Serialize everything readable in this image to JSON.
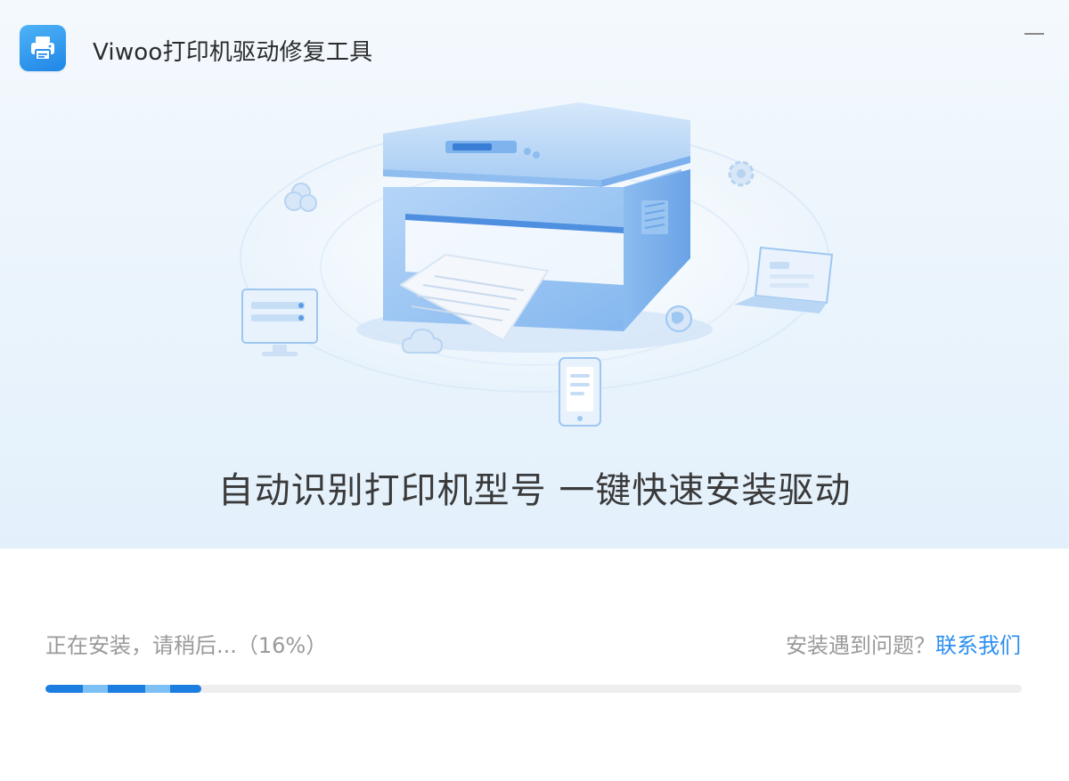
{
  "window": {
    "title": "Viwoo打印机驱动修复工具",
    "app_icon": "printer-icon",
    "minimize_icon": "minimize-icon"
  },
  "hero": {
    "tagline": "自动识别打印机型号  一键快速安装驱动",
    "illustration_icons": [
      "printer-icon",
      "monitor-icon",
      "laptop-icon",
      "phone-icon",
      "cloud-icon",
      "globe-icon",
      "gear-icon",
      "clouds-icon"
    ]
  },
  "install": {
    "status_text": "正在安装，请稍后...（16%）",
    "progress": 0.16,
    "help_text": "安装遇到问题？",
    "contact_label": "联系我们"
  },
  "colors": {
    "accent": "#2b8ff0",
    "progress_fill": "#1c7fe0",
    "progress_stripe": "#7cc0f5",
    "progress_track": "#eeeeee",
    "hero_bg": "#eaf4fc"
  }
}
